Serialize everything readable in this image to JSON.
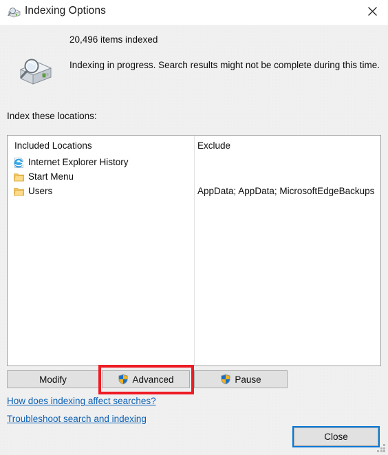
{
  "window": {
    "title": "Indexing Options",
    "title_icon": "indexing-drive-search-icon",
    "close_icon": "close-icon"
  },
  "header": {
    "status_icon": "drive-magnifier-icon",
    "items_indexed": "20,496 items indexed",
    "progress_message": "Indexing in progress. Search results might not be complete during this time."
  },
  "locations": {
    "label": "Index these locations:",
    "columns": {
      "included": "Included Locations",
      "exclude": "Exclude"
    },
    "rows": [
      {
        "icon": "internet-explorer-icon",
        "name": "Internet Explorer History",
        "exclude": ""
      },
      {
        "icon": "folder-icon",
        "name": "Start Menu",
        "exclude": ""
      },
      {
        "icon": "folder-icon",
        "name": "Users",
        "exclude": "AppData; AppData; MicrosoftEdgeBackups"
      }
    ]
  },
  "toolbar": {
    "modify_label": "Modify",
    "advanced_label": "Advanced",
    "pause_label": "Pause",
    "shield_icon": "uac-shield-icon"
  },
  "links": {
    "help": "How does indexing affect searches?",
    "troubleshoot": "Troubleshoot search and indexing"
  },
  "footer": {
    "close_label": "Close"
  },
  "annotation": {
    "highlight_target": "advanced-button",
    "highlight_color": "#ee1c25"
  },
  "colors": {
    "dialog_background": "#f0f0f0",
    "titlebar_background": "#ffffff",
    "list_background": "#ffffff",
    "button_face": "#e1e1e1",
    "button_border": "#adadad",
    "link": "#0b5fb3",
    "focus_ring": "#0078d7",
    "text": "#0d0d0d"
  }
}
